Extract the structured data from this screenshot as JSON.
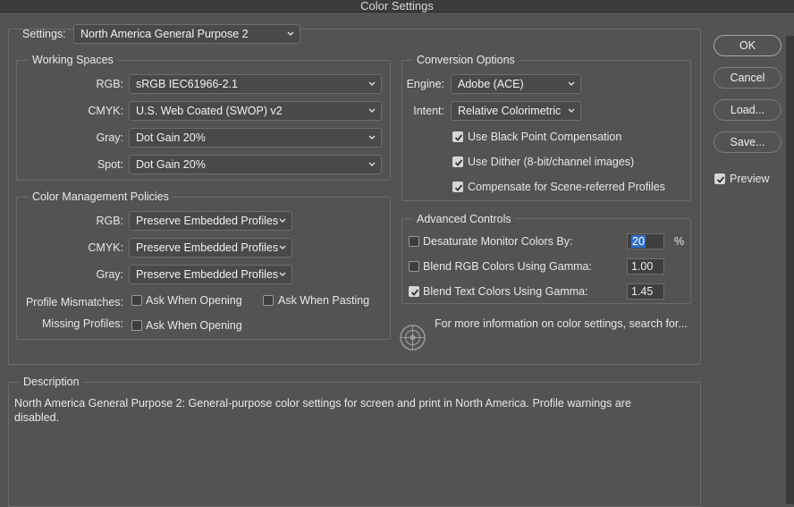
{
  "window": {
    "title": "Color Settings"
  },
  "settings": {
    "label": "Settings:",
    "value": "North America General Purpose 2"
  },
  "working_spaces": {
    "title": "Working Spaces",
    "rgb": {
      "label": "RGB:",
      "value": "sRGB IEC61966-2.1"
    },
    "cmyk": {
      "label": "CMYK:",
      "value": "U.S. Web Coated (SWOP) v2"
    },
    "gray": {
      "label": "Gray:",
      "value": "Dot Gain 20%"
    },
    "spot": {
      "label": "Spot:",
      "value": "Dot Gain 20%"
    }
  },
  "policies": {
    "title": "Color Management Policies",
    "rgb": {
      "label": "RGB:",
      "value": "Preserve Embedded Profiles"
    },
    "cmyk": {
      "label": "CMYK:",
      "value": "Preserve Embedded Profiles"
    },
    "gray": {
      "label": "Gray:",
      "value": "Preserve Embedded Profiles"
    },
    "mismatch_label": "Profile Mismatches:",
    "ask_opening": {
      "label": "Ask When Opening",
      "checked": false
    },
    "ask_pasting": {
      "label": "Ask When Pasting",
      "checked": false
    },
    "missing_label": "Missing Profiles:",
    "missing_ask_opening": {
      "label": "Ask When Opening",
      "checked": false
    }
  },
  "conversion": {
    "title": "Conversion Options",
    "engine": {
      "label": "Engine:",
      "value": "Adobe (ACE)"
    },
    "intent": {
      "label": "Intent:",
      "value": "Relative Colorimetric"
    },
    "black_point": {
      "label": "Use Black Point Compensation",
      "checked": true
    },
    "dither": {
      "label": "Use Dither (8-bit/channel images)",
      "checked": true
    },
    "scene_referred": {
      "label": "Compensate for Scene-referred Profiles",
      "checked": true
    }
  },
  "advanced": {
    "title": "Advanced Controls",
    "desaturate": {
      "label": "Desaturate Monitor Colors By:",
      "value": "20",
      "unit": "%",
      "checked": false
    },
    "blend_rgb": {
      "label": "Blend RGB Colors Using Gamma:",
      "value": "1.00",
      "checked": false
    },
    "blend_text": {
      "label": "Blend Text Colors Using Gamma:",
      "value": "1.45",
      "checked": true
    }
  },
  "info": {
    "text": "For more information on color settings, search for..."
  },
  "description": {
    "title": "Description",
    "text": "North America General Purpose 2:  General-purpose color settings for screen and print in North America. Profile warnings are disabled."
  },
  "buttons": {
    "ok": "OK",
    "cancel": "Cancel",
    "load": "Load...",
    "save": "Save..."
  },
  "preview": {
    "label": "Preview",
    "checked": true
  }
}
